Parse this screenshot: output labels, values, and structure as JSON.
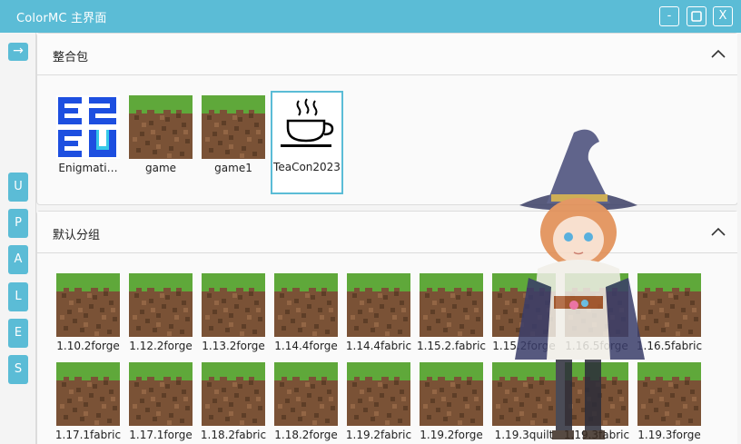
{
  "window": {
    "title": "ColorMC 主界面",
    "minimize_label": "-",
    "maximize_label": "▢",
    "close_label": "X"
  },
  "sidebar": {
    "toggle_label": "→",
    "letters": [
      "U",
      "P",
      "A",
      "L",
      "E",
      "S"
    ]
  },
  "groups": [
    {
      "title": "整合包",
      "items": [
        {
          "label": "Enigmati…",
          "icon": "enigmatica-logo"
        },
        {
          "label": "game",
          "icon": "grass-block"
        },
        {
          "label": "game1",
          "icon": "grass-block"
        },
        {
          "label": "TeaCon2023",
          "icon": "teacup-icon",
          "selected": true
        }
      ]
    },
    {
      "title": "默认分组",
      "items": [
        {
          "label": "1.10.2forge",
          "icon": "grass-block"
        },
        {
          "label": "1.12.2forge",
          "icon": "grass-block"
        },
        {
          "label": "1.13.2forge",
          "icon": "grass-block"
        },
        {
          "label": "1.14.4forge",
          "icon": "grass-block"
        },
        {
          "label": "1.14.4fabric",
          "icon": "grass-block"
        },
        {
          "label": "1.15.2.fabric",
          "icon": "grass-block"
        },
        {
          "label": "1.15.2forge",
          "icon": "grass-block"
        },
        {
          "label": "1.16.5forge",
          "icon": "grass-block"
        },
        {
          "label": "1.16.5fabric",
          "icon": "grass-block"
        },
        {
          "label": "1.17.1fabric",
          "icon": "grass-block"
        },
        {
          "label": "1.17.1forge",
          "icon": "grass-block"
        },
        {
          "label": "1.18.2fabric",
          "icon": "grass-block"
        },
        {
          "label": "1.18.2forge",
          "icon": "grass-block"
        },
        {
          "label": "1.19.2fabric",
          "icon": "grass-block"
        },
        {
          "label": "1.19.2forge",
          "icon": "grass-block"
        },
        {
          "label": "1.19.3quilt",
          "icon": "grass-block"
        },
        {
          "label": "1.19.3fabric",
          "icon": "grass-block"
        },
        {
          "label": "1.19.3forge",
          "icon": "grass-block"
        }
      ]
    }
  ],
  "colors": {
    "accent": "#5bbcd6",
    "grass": "#5fa83a",
    "dirt": "#7a5236"
  }
}
